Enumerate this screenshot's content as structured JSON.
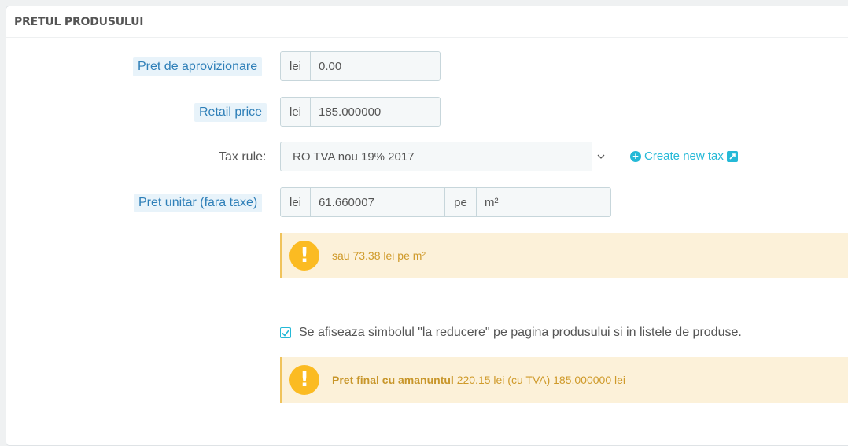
{
  "panel": {
    "title": "PRETUL PRODUSULUI"
  },
  "fields": {
    "wholesale": {
      "label": "Pret de aprovizionare",
      "currency": "lei",
      "value": "0.00"
    },
    "retail": {
      "label": "Retail price",
      "currency": "lei",
      "value": "185.000000"
    },
    "tax_rule": {
      "label": "Tax rule:",
      "selected": "RO TVA nou 19% 2017",
      "create_link": "Create new tax"
    },
    "unit_price": {
      "label": "Pret unitar (fara taxe)",
      "currency": "lei",
      "value": "61.660007",
      "per": "pe",
      "unit": "m²"
    }
  },
  "alerts": {
    "unit": {
      "text": "sau 73.38 lei pe m²"
    },
    "final": {
      "bold": "Pret final cu amanuntul",
      "text": "220.15 lei (cu TVA) 185.000000 lei"
    }
  },
  "on_sale": {
    "checked": true,
    "label": "Se afiseaza simbolul \"la reducere\" pe pagina produsului si in listele de produse."
  },
  "icons": [
    "warning-icon",
    "plus-circle-icon",
    "external-link-icon",
    "chevron-down-icon",
    "check-icon"
  ],
  "colors": {
    "accent": "#25b9d7",
    "hint_bg": "#e8f3fa",
    "hint_text": "#2e7fb8",
    "warning_bg": "#fcf1d9",
    "warning_icon": "#fbbb22"
  }
}
